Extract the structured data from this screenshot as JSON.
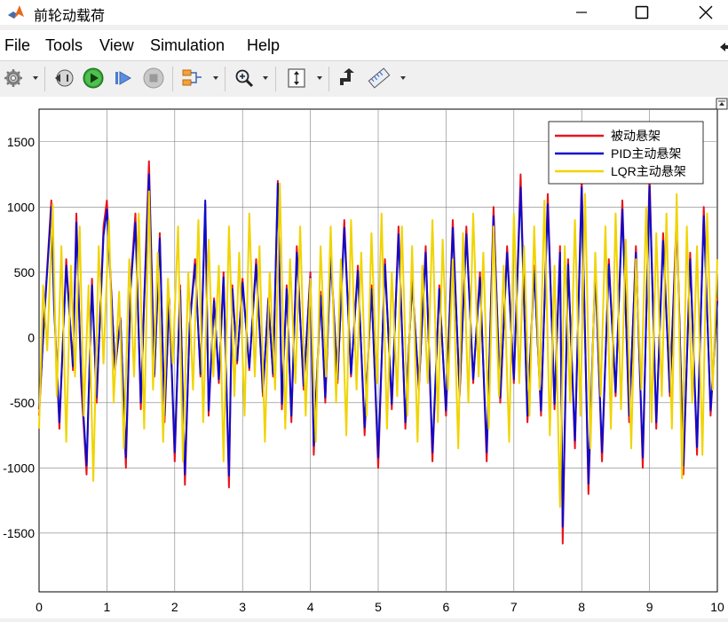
{
  "window": {
    "title": "前轮动载荷",
    "controls": [
      "minimize",
      "maximize",
      "close"
    ]
  },
  "menu": {
    "items": [
      "File",
      "Tools",
      "View",
      "Simulation",
      "Help"
    ]
  },
  "toolbar": {
    "buttons": [
      "settings-icon",
      "step-back-icon",
      "run-icon",
      "step-forward-icon",
      "stop-icon",
      "signal-selector-icon",
      "zoom-icon",
      "fit-axes-icon",
      "highlight-block-icon",
      "measure-icon"
    ]
  },
  "chart_data": {
    "type": "line",
    "title": "",
    "xlabel": "",
    "ylabel": "",
    "xlim": [
      0,
      10
    ],
    "ylim": [
      -1950,
      1750
    ],
    "xticks": [
      0,
      1,
      2,
      3,
      4,
      5,
      6,
      7,
      8,
      9,
      10
    ],
    "yticks": [
      -1500,
      -1000,
      -500,
      0,
      500,
      1000,
      1500
    ],
    "grid": true,
    "legend_position": "top-right",
    "series": [
      {
        "name": "被动悬架",
        "color": "#e8141c",
        "x": [
          0,
          0.08,
          0.18,
          0.22,
          0.3,
          0.4,
          0.5,
          0.55,
          0.62,
          0.7,
          0.78,
          0.85,
          0.95,
          1.0,
          1.12,
          1.2,
          1.28,
          1.35,
          1.42,
          1.5,
          1.55,
          1.62,
          1.7,
          1.78,
          1.85,
          1.92,
          2.0,
          2.08,
          2.15,
          2.22,
          2.3,
          2.38,
          2.45,
          2.5,
          2.58,
          2.65,
          2.72,
          2.8,
          2.85,
          2.92,
          3.0,
          3.1,
          3.2,
          3.3,
          3.38,
          3.45,
          3.52,
          3.58,
          3.65,
          3.72,
          3.8,
          3.9,
          4.0,
          4.05,
          4.15,
          4.22,
          4.3,
          4.4,
          4.5,
          4.6,
          4.7,
          4.8,
          4.9,
          5.0,
          5.1,
          5.2,
          5.3,
          5.4,
          5.5,
          5.6,
          5.7,
          5.8,
          5.9,
          6.0,
          6.1,
          6.2,
          6.3,
          6.4,
          6.5,
          6.6,
          6.7,
          6.8,
          6.9,
          7.0,
          7.1,
          7.2,
          7.3,
          7.4,
          7.5,
          7.6,
          7.68,
          7.72,
          7.8,
          7.9,
          8.0,
          8.1,
          8.2,
          8.3,
          8.4,
          8.5,
          8.6,
          8.7,
          8.8,
          8.9,
          9.0,
          9.1,
          9.2,
          9.3,
          9.4,
          9.5,
          9.6,
          9.7,
          9.8,
          9.9,
          10.0
        ],
        "y": [
          -600,
          200,
          1050,
          300,
          -700,
          600,
          -250,
          950,
          -350,
          -1050,
          450,
          -500,
          850,
          1050,
          -250,
          150,
          -1000,
          400,
          950,
          -550,
          300,
          1350,
          -300,
          800,
          -650,
          300,
          -950,
          400,
          -1130,
          100,
          600,
          -300,
          1020,
          -600,
          300,
          -350,
          500,
          -1150,
          400,
          -200,
          450,
          -250,
          600,
          -450,
          300,
          -300,
          1200,
          -550,
          400,
          -650,
          700,
          -400,
          500,
          -900,
          350,
          -500,
          650,
          -350,
          900,
          -300,
          550,
          -750,
          400,
          -1000,
          600,
          -550,
          850,
          -700,
          450,
          -400,
          700,
          -950,
          400,
          -600,
          900,
          -450,
          850,
          -350,
          500,
          -950,
          1000,
          -500,
          700,
          -350,
          1250,
          -650,
          550,
          -600,
          1100,
          -550,
          700,
          -1580,
          600,
          -850,
          1220,
          -1200,
          550,
          -950,
          600,
          -450,
          1050,
          -650,
          700,
          -1000,
          1250,
          -700,
          800,
          -450,
          950,
          -1050,
          650,
          -900,
          1000,
          -600,
          300
        ]
      },
      {
        "name": "PID主动悬架",
        "color": "#0c0ccc",
        "x": [
          0,
          0.08,
          0.18,
          0.22,
          0.3,
          0.4,
          0.5,
          0.55,
          0.62,
          0.7,
          0.78,
          0.85,
          0.95,
          1.0,
          1.12,
          1.2,
          1.28,
          1.35,
          1.42,
          1.5,
          1.55,
          1.62,
          1.7,
          1.78,
          1.85,
          1.92,
          2.0,
          2.08,
          2.15,
          2.22,
          2.3,
          2.38,
          2.45,
          2.5,
          2.58,
          2.65,
          2.72,
          2.8,
          2.85,
          2.92,
          3.0,
          3.1,
          3.2,
          3.3,
          3.38,
          3.45,
          3.52,
          3.58,
          3.65,
          3.72,
          3.8,
          3.9,
          4.0,
          4.05,
          4.15,
          4.22,
          4.3,
          4.4,
          4.5,
          4.6,
          4.7,
          4.8,
          4.9,
          5.0,
          5.1,
          5.2,
          5.3,
          5.4,
          5.5,
          5.6,
          5.7,
          5.8,
          5.9,
          6.0,
          6.1,
          6.2,
          6.3,
          6.4,
          6.5,
          6.6,
          6.7,
          6.8,
          6.9,
          7.0,
          7.1,
          7.2,
          7.3,
          7.4,
          7.5,
          7.6,
          7.68,
          7.72,
          7.8,
          7.9,
          8.0,
          8.1,
          8.2,
          8.3,
          8.4,
          8.5,
          8.6,
          8.7,
          8.8,
          8.9,
          9.0,
          9.1,
          9.2,
          9.3,
          9.4,
          9.5,
          9.6,
          9.7,
          9.8,
          9.9,
          10.0
        ],
        "y": [
          -550,
          180,
          1000,
          250,
          -650,
          550,
          -220,
          880,
          -300,
          -980,
          400,
          -460,
          780,
          980,
          -230,
          130,
          -920,
          370,
          880,
          -500,
          270,
          1250,
          -280,
          760,
          -600,
          280,
          -880,
          360,
          -1050,
          90,
          560,
          -280,
          1050,
          -560,
          280,
          -320,
          460,
          -1060,
          370,
          -180,
          420,
          -230,
          560,
          -420,
          280,
          -280,
          1180,
          -510,
          370,
          -600,
          650,
          -370,
          460,
          -830,
          320,
          -460,
          600,
          -320,
          840,
          -280,
          510,
          -690,
          370,
          -920,
          560,
          -510,
          790,
          -650,
          420,
          -370,
          650,
          -880,
          370,
          -560,
          840,
          -420,
          790,
          -320,
          460,
          -880,
          930,
          -460,
          650,
          -320,
          1150,
          -600,
          510,
          -560,
          1020,
          -510,
          650,
          -1450,
          560,
          -790,
          1150,
          -1120,
          510,
          -880,
          560,
          -420,
          980,
          -600,
          650,
          -920,
          1160,
          -650,
          740,
          -420,
          880,
          -980,
          600,
          -840,
          930,
          -560,
          280
        ]
      },
      {
        "name": "LQR主动悬架",
        "color": "#f0d400",
        "x": [
          0,
          0.06,
          0.12,
          0.2,
          0.26,
          0.33,
          0.4,
          0.47,
          0.53,
          0.6,
          0.66,
          0.73,
          0.8,
          0.88,
          0.95,
          1.03,
          1.1,
          1.18,
          1.25,
          1.33,
          1.4,
          1.47,
          1.55,
          1.62,
          1.68,
          1.75,
          1.83,
          1.9,
          1.97,
          2.05,
          2.12,
          2.2,
          2.27,
          2.35,
          2.42,
          2.5,
          2.57,
          2.65,
          2.72,
          2.8,
          2.88,
          2.95,
          3.03,
          3.1,
          3.18,
          3.25,
          3.33,
          3.4,
          3.48,
          3.55,
          3.63,
          3.7,
          3.78,
          3.85,
          3.93,
          4.0,
          4.08,
          4.15,
          4.23,
          4.3,
          4.38,
          4.45,
          4.53,
          4.6,
          4.68,
          4.75,
          4.83,
          4.9,
          4.98,
          5.05,
          5.13,
          5.2,
          5.28,
          5.35,
          5.43,
          5.5,
          5.58,
          5.65,
          5.73,
          5.8,
          5.88,
          5.95,
          6.03,
          6.1,
          6.18,
          6.25,
          6.33,
          6.4,
          6.48,
          6.55,
          6.63,
          6.7,
          6.78,
          6.85,
          6.93,
          7.0,
          7.08,
          7.15,
          7.23,
          7.3,
          7.38,
          7.45,
          7.53,
          7.6,
          7.68,
          7.75,
          7.83,
          7.9,
          7.98,
          8.05,
          8.13,
          8.2,
          8.28,
          8.35,
          8.43,
          8.5,
          8.58,
          8.65,
          8.73,
          8.8,
          8.88,
          8.95,
          9.03,
          9.1,
          9.18,
          9.25,
          9.33,
          9.4,
          9.48,
          9.55,
          9.63,
          9.7,
          9.78,
          9.85,
          9.93,
          10.0
        ],
        "y": [
          -700,
          400,
          -100,
          1020,
          -450,
          700,
          -800,
          550,
          -300,
          850,
          -600,
          400,
          -1100,
          700,
          -200,
          900,
          -500,
          350,
          -850,
          600,
          -300,
          950,
          -700,
          1120,
          -400,
          650,
          -800,
          450,
          -200,
          850,
          -950,
          500,
          -400,
          900,
          -650,
          750,
          -300,
          550,
          -950,
          850,
          -450,
          650,
          -600,
          950,
          -300,
          700,
          -800,
          500,
          -400,
          1180,
          -700,
          600,
          -350,
          850,
          -600,
          450,
          -800,
          700,
          -300,
          850,
          -500,
          600,
          -750,
          900,
          -400,
          650,
          -600,
          800,
          -350,
          950,
          -700,
          500,
          -450,
          850,
          -600,
          700,
          -800,
          550,
          -350,
          900,
          -650,
          750,
          -400,
          600,
          -850,
          800,
          -500,
          950,
          -300,
          650,
          -700,
          850,
          -450,
          550,
          -800,
          950,
          -350,
          700,
          -600,
          850,
          -400,
          1050,
          -750,
          550,
          -1300,
          700,
          -500,
          900,
          -600,
          1100,
          -850,
          650,
          -450,
          850,
          -700,
          950,
          -550,
          750,
          -850,
          600,
          -400,
          1000,
          -650,
          800,
          -450,
          950,
          -700,
          1100,
          -1080,
          850,
          -500,
          700,
          -900,
          950,
          -400,
          600
        ]
      }
    ]
  }
}
